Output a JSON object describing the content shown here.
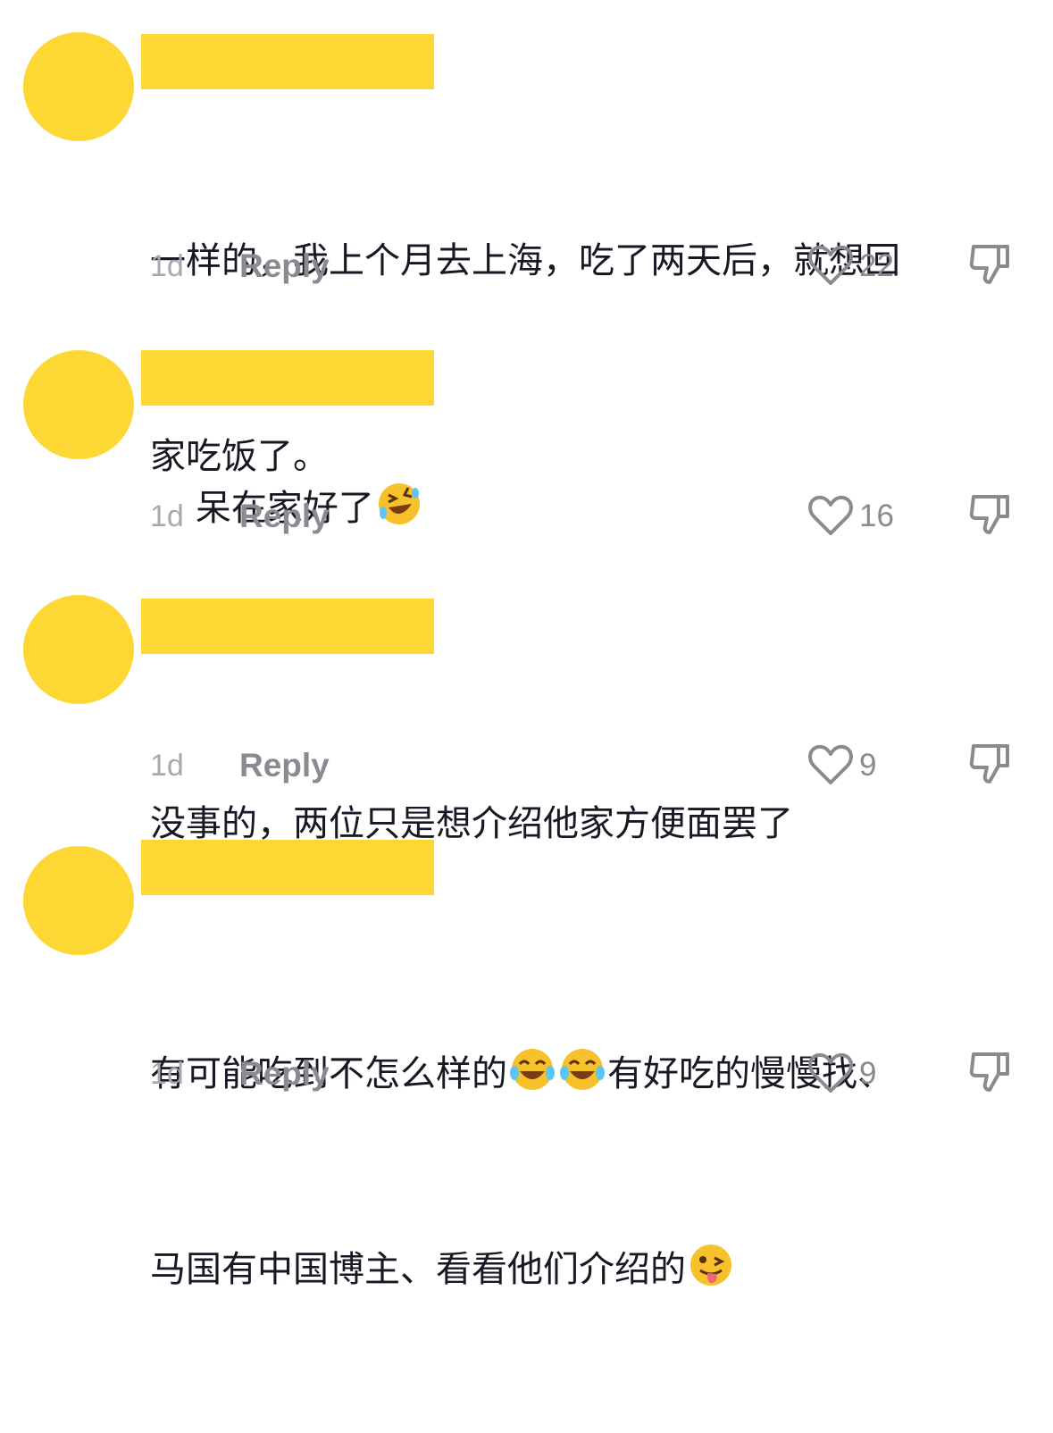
{
  "comments": [
    {
      "text_lines": [
        "一样的，我上个月去上海，吃了两天后，就想回",
        "家吃饭了。"
      ],
      "time": "1d",
      "reply_label": "Reply",
      "likes": "22"
    },
    {
      "text_lines": [
        "呆在家好了"
      ],
      "emoji": "rolling-on-floor-laughing-emoji",
      "time": "1d",
      "reply_label": "Reply",
      "likes": "16"
    },
    {
      "text_lines": [
        "没事的，两位只是想介绍他家方便面罢了"
      ],
      "time": "1d",
      "reply_label": "Reply",
      "likes": "9"
    },
    {
      "line1_a": "有可能吃到不怎么样的",
      "line1_b": "有好吃的慢慢找、",
      "line2": "马国有中国博主、看看他们介绍的",
      "emojis": [
        "tears-of-joy-emoji",
        "tears-of-joy-emoji",
        "zany-tongue-emoji"
      ],
      "time": "1d",
      "reply_label": "Reply",
      "likes": "9"
    }
  ],
  "colors": {
    "avatar": "#fdd835",
    "name_redaction": "#fdd835",
    "text": "#161823",
    "muted": "#8a8b91"
  },
  "icons": [
    "heart-outline-icon",
    "thumbs-down-icon"
  ]
}
